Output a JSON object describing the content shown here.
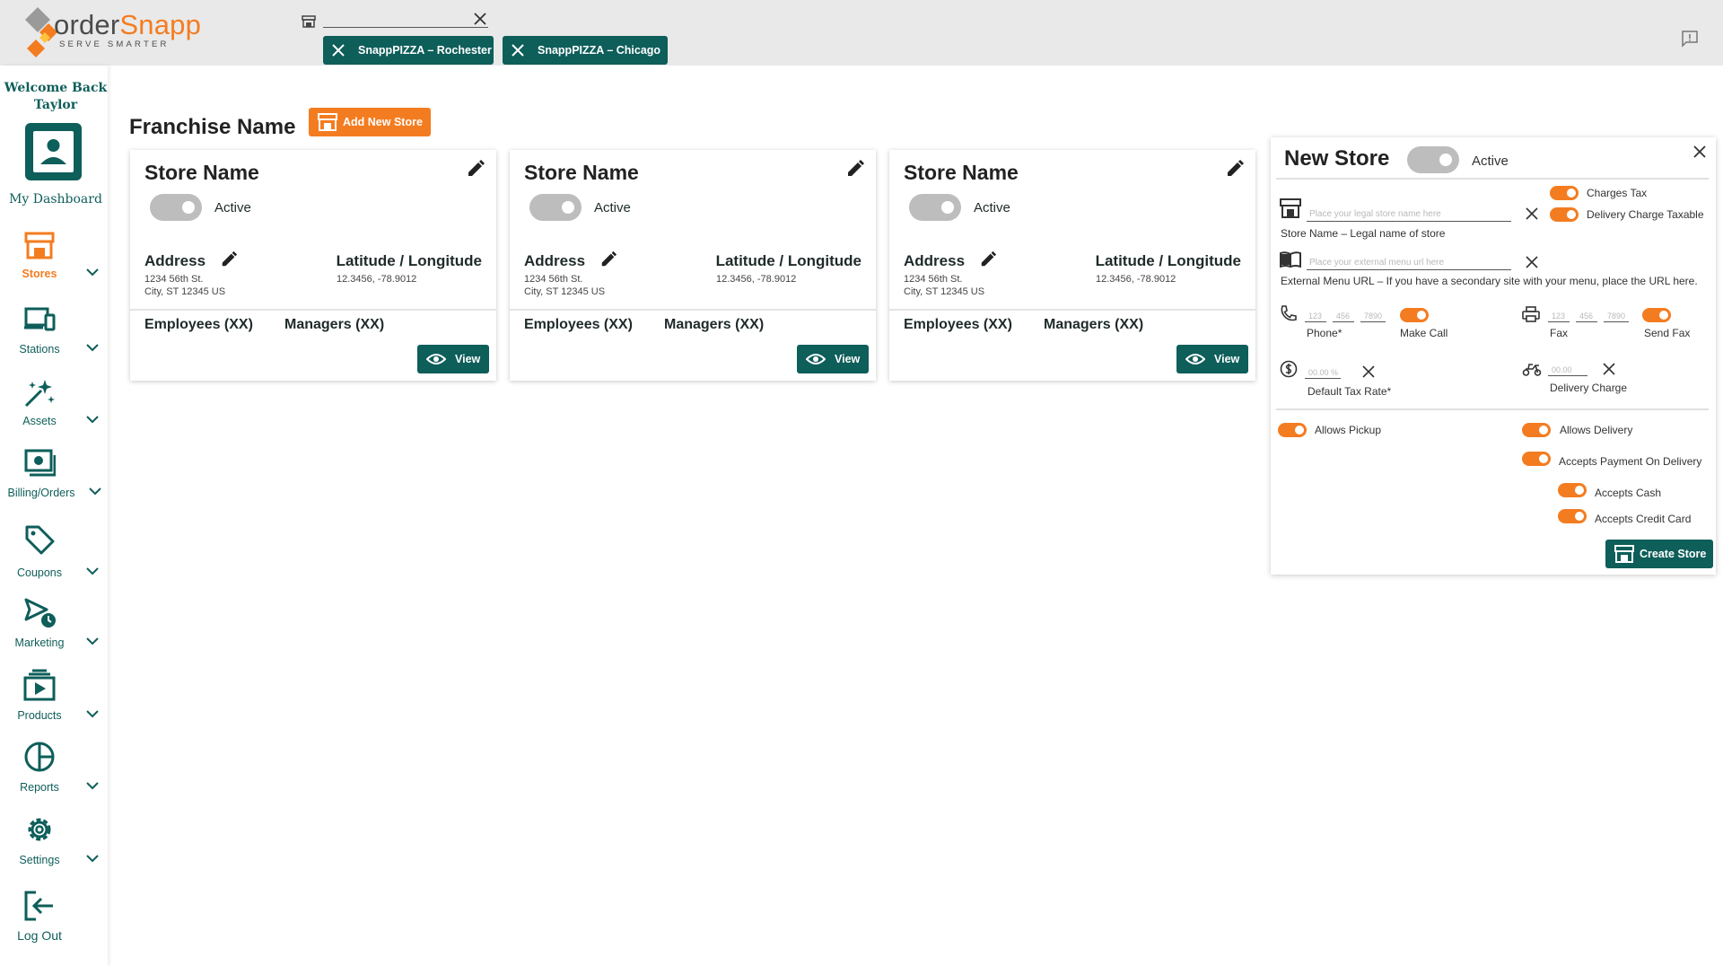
{
  "brand": {
    "name_prefix": "order",
    "name_suffix": "Snapp",
    "tagline": "SERVE SMARTER"
  },
  "topbar": {
    "store_chips": [
      "SnappPIZZA – Rochester",
      "SnappPIZZA – Chicago"
    ]
  },
  "sidebar": {
    "welcome": "Welcome Back Taylor",
    "dashboard_label": "My Dashboard",
    "items": [
      {
        "label": "Stores",
        "icon": "store-icon",
        "active": true
      },
      {
        "label": "Stations",
        "icon": "stations-icon"
      },
      {
        "label": "Assets",
        "icon": "sparkle-icon"
      },
      {
        "label": "Billing/Orders",
        "icon": "billing-icon"
      },
      {
        "label": "Coupons",
        "icon": "tag-icon"
      },
      {
        "label": "Marketing",
        "icon": "megaphone-icon"
      },
      {
        "label": "Products",
        "icon": "products-icon"
      },
      {
        "label": "Reports",
        "icon": "pie-chart-icon"
      },
      {
        "label": "Settings",
        "icon": "gear-icon"
      },
      {
        "label": "Log Out",
        "icon": "logout-icon"
      }
    ]
  },
  "main": {
    "franchise_title": "Franchise Name",
    "add_store_label": "Add New Store",
    "cards": [
      {
        "name": "Store Name",
        "status": "Active",
        "address_heading": "Address",
        "address_line1": "1234 56th St.",
        "address_line2": "City, ST 12345 US",
        "latlong_heading": "Latitude / Longitude",
        "latlong": "12.3456, -78.9012",
        "employees": "Employees (XX)",
        "managers": "Managers (XX)",
        "view_label": "View"
      },
      {
        "name": "Store Name",
        "status": "Active",
        "address_heading": "Address",
        "address_line1": "1234 56th St.",
        "address_line2": "City, ST 12345 US",
        "latlong_heading": "Latitude / Longitude",
        "latlong": "12.3456, -78.9012",
        "employees": "Employees (XX)",
        "managers": "Managers (XX)",
        "view_label": "View"
      },
      {
        "name": "Store Name",
        "status": "Active",
        "address_heading": "Address",
        "address_line1": "1234 56th St.",
        "address_line2": "City, ST 12345 US",
        "latlong_heading": "Latitude / Longitude",
        "latlong": "12.3456, -78.9012",
        "employees": "Employees (XX)",
        "managers": "Managers (XX)",
        "view_label": "View"
      }
    ]
  },
  "new_store": {
    "title": "New Store",
    "status": "Active",
    "charges_tax": "Charges Tax",
    "delivery_charge_taxable": "Delivery Charge Taxable",
    "store_name_placeholder": "Place your legal store name here",
    "store_name_label": "Store Name – Legal name of store",
    "menu_url_placeholder": "Place your external menu url here",
    "menu_url_label": "External Menu URL – If you have a secondary site with your menu, place the URL here.",
    "phone_parts": [
      "123",
      "456",
      "7890"
    ],
    "phone_label": "Phone*",
    "make_call": "Make Call",
    "fax_parts": [
      "123",
      "456",
      "7890"
    ],
    "fax_label": "Fax",
    "send_fax": "Send Fax",
    "tax_placeholder": "00.00 %",
    "tax_label": "Default Tax Rate*",
    "delivery_placeholder": "00.00",
    "delivery_label": "Delivery Charge",
    "allows_pickup": "Allows Pickup",
    "allows_delivery": "Allows Delivery",
    "accepts_payment_on_delivery": "Accepts Payment On Delivery",
    "accepts_cash": "Accepts Cash",
    "accepts_credit_card": "Accepts Credit Card",
    "create_label": "Create Store"
  },
  "colors": {
    "teal": "#0e5e5a",
    "orange": "#f47c20",
    "toggle_off": "#bdbdbd"
  }
}
